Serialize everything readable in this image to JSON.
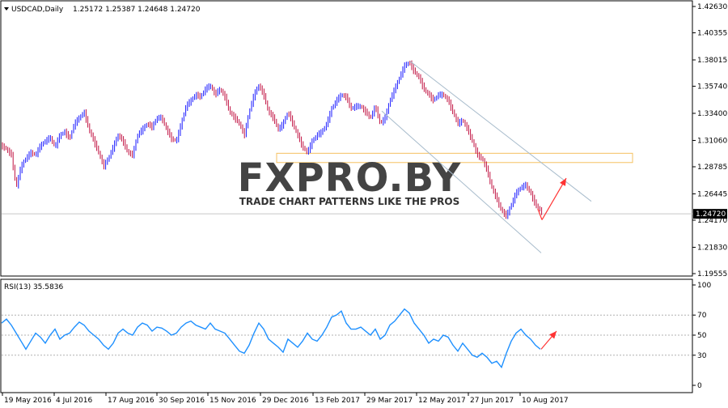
{
  "chart_data": [
    {
      "type": "bar",
      "subtype": "ohlc",
      "symbol_label": "USDCAD,Daily",
      "ohlc_header": "1.25172 1.25387 1.24648 1.24720",
      "current_price_label": "1.24720",
      "current_price": 1.2472,
      "y_ticks": [
        "1.42630",
        "1.40355",
        "1.38015",
        "1.35740",
        "1.33400",
        "1.31060",
        "1.28785",
        "1.26445",
        "1.24170",
        "1.21830",
        "1.19555"
      ],
      "ylim": [
        1.19555,
        1.4263
      ],
      "x_ticks": [
        "19 May 2016",
        "4 Jul 2016",
        "17 Aug 2016",
        "30 Sep 2016",
        "15 Nov 2016",
        "29 Dec 2016",
        "13 Feb 2017",
        "29 Mar 2017",
        "12 May 2017",
        "27 Jun 2017",
        "10 Aug 2017"
      ],
      "up_color": "#1a1aff",
      "down_color": "#c01040",
      "close_path": [
        [
          0,
          1.306
        ],
        [
          6,
          1.303
        ],
        [
          12,
          1.298
        ],
        [
          18,
          1.27
        ],
        [
          24,
          1.288
        ],
        [
          30,
          1.295
        ],
        [
          36,
          1.3
        ],
        [
          42,
          1.298
        ],
        [
          48,
          1.306
        ],
        [
          54,
          1.31
        ],
        [
          60,
          1.313
        ],
        [
          66,
          1.305
        ],
        [
          72,
          1.315
        ],
        [
          78,
          1.318
        ],
        [
          84,
          1.312
        ],
        [
          90,
          1.325
        ],
        [
          96,
          1.33
        ],
        [
          102,
          1.335
        ],
        [
          108,
          1.32
        ],
        [
          114,
          1.31
        ],
        [
          120,
          1.3
        ],
        [
          126,
          1.288
        ],
        [
          132,
          1.295
        ],
        [
          138,
          1.305
        ],
        [
          144,
          1.315
        ],
        [
          150,
          1.31
        ],
        [
          156,
          1.3
        ],
        [
          162,
          1.298
        ],
        [
          168,
          1.315
        ],
        [
          174,
          1.32
        ],
        [
          180,
          1.325
        ],
        [
          186,
          1.322
        ],
        [
          192,
          1.33
        ],
        [
          198,
          1.33
        ],
        [
          204,
          1.32
        ],
        [
          210,
          1.312
        ],
        [
          216,
          1.31
        ],
        [
          222,
          1.325
        ],
        [
          228,
          1.34
        ],
        [
          234,
          1.345
        ],
        [
          240,
          1.35
        ],
        [
          246,
          1.348
        ],
        [
          252,
          1.355
        ],
        [
          258,
          1.358
        ],
        [
          264,
          1.35
        ],
        [
          270,
          1.355
        ],
        [
          276,
          1.348
        ],
        [
          282,
          1.335
        ],
        [
          288,
          1.33
        ],
        [
          294,
          1.325
        ],
        [
          300,
          1.315
        ],
        [
          306,
          1.335
        ],
        [
          312,
          1.35
        ],
        [
          318,
          1.358
        ],
        [
          324,
          1.35
        ],
        [
          330,
          1.335
        ],
        [
          336,
          1.33
        ],
        [
          342,
          1.32
        ],
        [
          348,
          1.325
        ],
        [
          354,
          1.335
        ],
        [
          360,
          1.325
        ],
        [
          366,
          1.315
        ],
        [
          372,
          1.305
        ],
        [
          378,
          1.3
        ],
        [
          384,
          1.31
        ],
        [
          390,
          1.315
        ],
        [
          396,
          1.318
        ],
        [
          402,
          1.325
        ],
        [
          408,
          1.338
        ],
        [
          414,
          1.345
        ],
        [
          420,
          1.35
        ],
        [
          426,
          1.348
        ],
        [
          432,
          1.338
        ],
        [
          438,
          1.34
        ],
        [
          444,
          1.34
        ],
        [
          450,
          1.335
        ],
        [
          456,
          1.33
        ],
        [
          462,
          1.34
        ],
        [
          468,
          1.325
        ],
        [
          474,
          1.33
        ],
        [
          480,
          1.345
        ],
        [
          486,
          1.355
        ],
        [
          492,
          1.365
        ],
        [
          498,
          1.375
        ],
        [
          504,
          1.378
        ],
        [
          510,
          1.37
        ],
        [
          516,
          1.365
        ],
        [
          522,
          1.355
        ],
        [
          528,
          1.35
        ],
        [
          534,
          1.345
        ],
        [
          540,
          1.35
        ],
        [
          546,
          1.35
        ],
        [
          552,
          1.345
        ],
        [
          558,
          1.335
        ],
        [
          564,
          1.325
        ],
        [
          570,
          1.328
        ],
        [
          576,
          1.32
        ],
        [
          582,
          1.31
        ],
        [
          588,
          1.298
        ],
        [
          594,
          1.295
        ],
        [
          600,
          1.285
        ],
        [
          606,
          1.27
        ],
        [
          612,
          1.26
        ],
        [
          618,
          1.25
        ],
        [
          624,
          1.245
        ],
        [
          630,
          1.255
        ],
        [
          636,
          1.265
        ],
        [
          642,
          1.27
        ],
        [
          648,
          1.272
        ],
        [
          654,
          1.265
        ],
        [
          660,
          1.255
        ],
        [
          666,
          1.25
        ],
        [
          669,
          1.2472
        ]
      ],
      "channel_upper": [
        [
          505,
          1.379
        ],
        [
          729,
          1.258
        ]
      ],
      "channel_lower": [
        [
          470,
          1.336
        ],
        [
          667,
          1.2135
        ]
      ],
      "zone": {
        "price_low": 1.2915,
        "price_high": 1.2995,
        "x_start": 340,
        "x_end": 780
      },
      "forecast_arrow": [
        [
          668,
          1.242
        ],
        [
          698,
          1.278
        ]
      ],
      "arrow_color": "#ff3333",
      "channel_color": "#a8bccc",
      "zone_color": "#f5c060"
    },
    {
      "type": "line",
      "label": "RSI(13) 35.5836",
      "value": 35.5836,
      "y_ticks": [
        "100",
        "70",
        "50",
        "30",
        "0"
      ],
      "ylim": [
        0,
        100
      ],
      "line_color": "#1e90ff",
      "levels": [
        70,
        50,
        30
      ],
      "path": [
        [
          0,
          62
        ],
        [
          6,
          66
        ],
        [
          12,
          60
        ],
        [
          18,
          52
        ],
        [
          24,
          44
        ],
        [
          30,
          36
        ],
        [
          36,
          44
        ],
        [
          42,
          52
        ],
        [
          48,
          48
        ],
        [
          54,
          42
        ],
        [
          60,
          50
        ],
        [
          66,
          56
        ],
        [
          72,
          46
        ],
        [
          78,
          50
        ],
        [
          84,
          52
        ],
        [
          90,
          58
        ],
        [
          96,
          63
        ],
        [
          102,
          60
        ],
        [
          108,
          54
        ],
        [
          114,
          50
        ],
        [
          120,
          46
        ],
        [
          126,
          40
        ],
        [
          132,
          36
        ],
        [
          138,
          42
        ],
        [
          144,
          52
        ],
        [
          150,
          56
        ],
        [
          156,
          52
        ],
        [
          162,
          50
        ],
        [
          168,
          58
        ],
        [
          174,
          62
        ],
        [
          180,
          60
        ],
        [
          186,
          54
        ],
        [
          192,
          58
        ],
        [
          198,
          57
        ],
        [
          204,
          54
        ],
        [
          210,
          50
        ],
        [
          216,
          52
        ],
        [
          222,
          58
        ],
        [
          228,
          62
        ],
        [
          234,
          64
        ],
        [
          240,
          60
        ],
        [
          246,
          58
        ],
        [
          252,
          56
        ],
        [
          258,
          62
        ],
        [
          264,
          56
        ],
        [
          270,
          54
        ],
        [
          276,
          52
        ],
        [
          282,
          46
        ],
        [
          288,
          40
        ],
        [
          294,
          34
        ],
        [
          300,
          32
        ],
        [
          306,
          40
        ],
        [
          312,
          52
        ],
        [
          318,
          62
        ],
        [
          324,
          56
        ],
        [
          330,
          46
        ],
        [
          336,
          42
        ],
        [
          342,
          38
        ],
        [
          348,
          33
        ],
        [
          354,
          46
        ],
        [
          360,
          42
        ],
        [
          366,
          38
        ],
        [
          372,
          44
        ],
        [
          378,
          52
        ],
        [
          384,
          46
        ],
        [
          390,
          44
        ],
        [
          396,
          50
        ],
        [
          402,
          58
        ],
        [
          408,
          68
        ],
        [
          414,
          70
        ],
        [
          420,
          74
        ],
        [
          426,
          62
        ],
        [
          432,
          56
        ],
        [
          438,
          56
        ],
        [
          444,
          58
        ],
        [
          450,
          54
        ],
        [
          456,
          50
        ],
        [
          462,
          56
        ],
        [
          468,
          46
        ],
        [
          474,
          50
        ],
        [
          480,
          60
        ],
        [
          486,
          64
        ],
        [
          492,
          70
        ],
        [
          498,
          76
        ],
        [
          504,
          72
        ],
        [
          510,
          62
        ],
        [
          516,
          56
        ],
        [
          522,
          50
        ],
        [
          528,
          42
        ],
        [
          534,
          46
        ],
        [
          540,
          44
        ],
        [
          546,
          50
        ],
        [
          552,
          48
        ],
        [
          558,
          40
        ],
        [
          564,
          34
        ],
        [
          570,
          42
        ],
        [
          576,
          36
        ],
        [
          582,
          30
        ],
        [
          588,
          28
        ],
        [
          594,
          32
        ],
        [
          600,
          28
        ],
        [
          606,
          22
        ],
        [
          612,
          24
        ],
        [
          618,
          18
        ],
        [
          624,
          32
        ],
        [
          630,
          44
        ],
        [
          636,
          52
        ],
        [
          642,
          56
        ],
        [
          648,
          50
        ],
        [
          654,
          46
        ],
        [
          660,
          40
        ],
        [
          666,
          36
        ]
      ],
      "forecast_arrow": [
        [
          667,
          36
        ],
        [
          686,
          54
        ]
      ],
      "arrow_color": "#ff3333"
    }
  ],
  "watermark": {
    "brand": "FXPRO.BY",
    "tagline": "TRADE CHART PATTERNS LIKE THE PROS"
  }
}
